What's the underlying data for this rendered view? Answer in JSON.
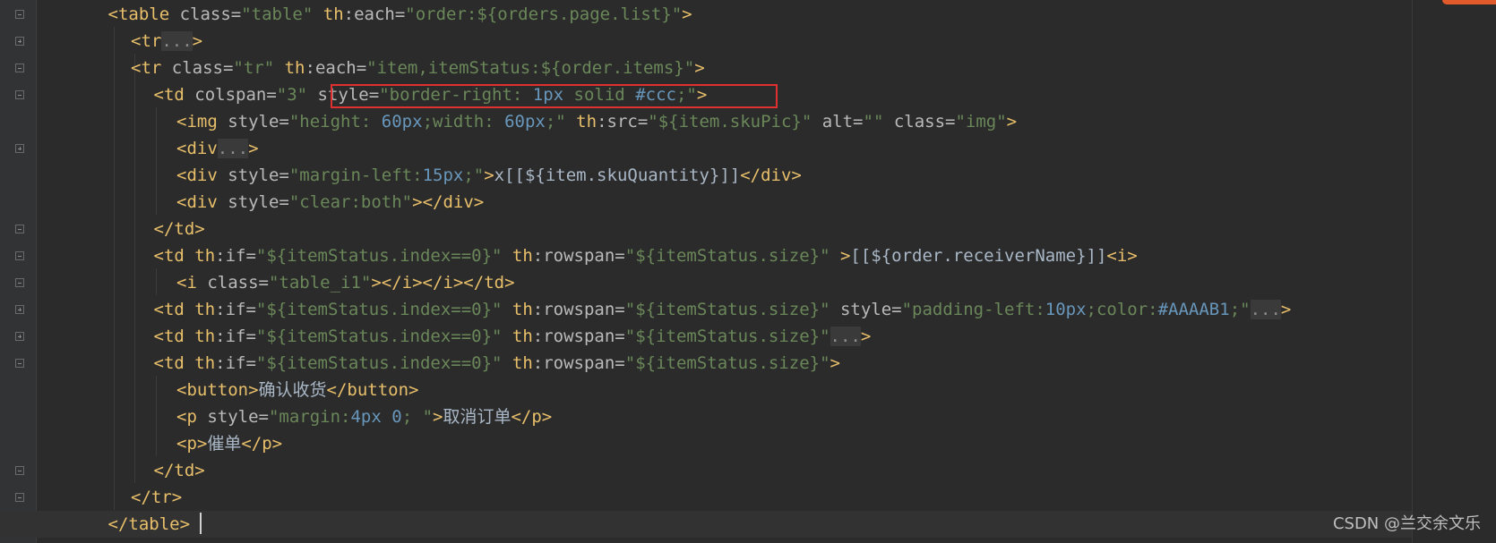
{
  "code_lines": [
    {
      "indent": 3,
      "parts": [
        {
          "t": "<",
          "c": "t"
        },
        {
          "t": "table",
          "c": "t"
        },
        {
          "t": " class=",
          "c": "a"
        },
        {
          "t": "\"table\"",
          "c": "s"
        },
        {
          "t": " th",
          "c": "t"
        },
        {
          "t": ":each=",
          "c": "a"
        },
        {
          "t": "\"",
          "c": "s"
        },
        {
          "t": "order:${orders.page.list}",
          "c": "s"
        },
        {
          "t": "\"",
          "c": "s"
        },
        {
          "t": ">",
          "c": "t"
        }
      ]
    },
    {
      "indent": 4,
      "parts": [
        {
          "t": "<tr",
          "c": "t"
        },
        {
          "t": "...",
          "c": "f"
        },
        {
          "t": ">",
          "c": "t"
        }
      ]
    },
    {
      "indent": 4,
      "parts": [
        {
          "t": "<tr",
          "c": "t"
        },
        {
          "t": " class=",
          "c": "a"
        },
        {
          "t": "\"tr\"",
          "c": "s"
        },
        {
          "t": " th",
          "c": "t"
        },
        {
          "t": ":each=",
          "c": "a"
        },
        {
          "t": "\"item,itemStatus:${order.items}\"",
          "c": "s"
        },
        {
          "t": ">",
          "c": "t"
        }
      ]
    },
    {
      "indent": 5,
      "parts": [
        {
          "t": "<td",
          "c": "t"
        },
        {
          "t": " colspan=",
          "c": "a"
        },
        {
          "t": "\"3\"",
          "c": "s"
        },
        {
          "t": " style=",
          "c": "a"
        },
        {
          "t": "\"border-right: ",
          "c": "s"
        },
        {
          "t": "1px",
          "c": "n"
        },
        {
          "t": " solid ",
          "c": "s"
        },
        {
          "t": "#ccc",
          "c": "n"
        },
        {
          "t": ";\"",
          "c": "s"
        },
        {
          "t": ">",
          "c": "t"
        }
      ]
    },
    {
      "indent": 6,
      "parts": [
        {
          "t": "<img",
          "c": "t"
        },
        {
          "t": " style=",
          "c": "a"
        },
        {
          "t": "\"height: ",
          "c": "s"
        },
        {
          "t": "60px",
          "c": "n"
        },
        {
          "t": ";width: ",
          "c": "s"
        },
        {
          "t": "60px",
          "c": "n"
        },
        {
          "t": ";\"",
          "c": "s"
        },
        {
          "t": " th",
          "c": "t"
        },
        {
          "t": ":src=",
          "c": "a"
        },
        {
          "t": "\"${item.skuPic}\"",
          "c": "s"
        },
        {
          "t": " alt=",
          "c": "a"
        },
        {
          "t": "\"\"",
          "c": "s"
        },
        {
          "t": " class=",
          "c": "a"
        },
        {
          "t": "\"img\"",
          "c": "s"
        },
        {
          "t": ">",
          "c": "t"
        }
      ]
    },
    {
      "indent": 6,
      "parts": [
        {
          "t": "<div",
          "c": "t"
        },
        {
          "t": "...",
          "c": "f"
        },
        {
          "t": ">",
          "c": "t"
        }
      ]
    },
    {
      "indent": 6,
      "parts": [
        {
          "t": "<div",
          "c": "t"
        },
        {
          "t": " style=",
          "c": "a"
        },
        {
          "t": "\"margin-left:",
          "c": "s"
        },
        {
          "t": "15px",
          "c": "n"
        },
        {
          "t": ";\"",
          "c": "s"
        },
        {
          "t": ">",
          "c": "t"
        },
        {
          "t": "x[[${item.skuQuantity}]]",
          "c": "d"
        },
        {
          "t": "</div>",
          "c": "t"
        }
      ]
    },
    {
      "indent": 6,
      "parts": [
        {
          "t": "<div",
          "c": "t"
        },
        {
          "t": " style=",
          "c": "a"
        },
        {
          "t": "\"clear:both\"",
          "c": "s"
        },
        {
          "t": "></div>",
          "c": "t"
        }
      ]
    },
    {
      "indent": 5,
      "parts": [
        {
          "t": "</td>",
          "c": "t"
        }
      ]
    },
    {
      "indent": 5,
      "parts": [
        {
          "t": "<td",
          "c": "t"
        },
        {
          "t": " th",
          "c": "t"
        },
        {
          "t": ":if=",
          "c": "a"
        },
        {
          "t": "\"${itemStatus.index==0}\"",
          "c": "s"
        },
        {
          "t": " th",
          "c": "t"
        },
        {
          "t": ":rowspan=",
          "c": "a"
        },
        {
          "t": "\"${itemStatus.size}\"",
          "c": "s"
        },
        {
          "t": " >",
          "c": "t"
        },
        {
          "t": "[[${order.receiverName}]]",
          "c": "d"
        },
        {
          "t": "<i>",
          "c": "t"
        }
      ]
    },
    {
      "indent": 6,
      "parts": [
        {
          "t": "<i",
          "c": "t"
        },
        {
          "t": " class=",
          "c": "a"
        },
        {
          "t": "\"table_i1\"",
          "c": "s"
        },
        {
          "t": "></i></i></td>",
          "c": "t"
        }
      ]
    },
    {
      "indent": 5,
      "parts": [
        {
          "t": "<td",
          "c": "t"
        },
        {
          "t": " th",
          "c": "t"
        },
        {
          "t": ":if=",
          "c": "a"
        },
        {
          "t": "\"${itemStatus.index==0}\"",
          "c": "s"
        },
        {
          "t": " th",
          "c": "t"
        },
        {
          "t": ":rowspan=",
          "c": "a"
        },
        {
          "t": "\"${itemStatus.size}\"",
          "c": "s"
        },
        {
          "t": " style=",
          "c": "a"
        },
        {
          "t": "\"padding-left:",
          "c": "s"
        },
        {
          "t": "10px",
          "c": "n"
        },
        {
          "t": ";color:",
          "c": "s"
        },
        {
          "t": "#AAAAB1",
          "c": "n"
        },
        {
          "t": ";\"",
          "c": "s"
        },
        {
          "t": "...",
          "c": "f"
        },
        {
          "t": ">",
          "c": "t"
        }
      ]
    },
    {
      "indent": 5,
      "parts": [
        {
          "t": "<td",
          "c": "t"
        },
        {
          "t": " th",
          "c": "t"
        },
        {
          "t": ":if=",
          "c": "a"
        },
        {
          "t": "\"${itemStatus.index==0}\"",
          "c": "s"
        },
        {
          "t": " th",
          "c": "t"
        },
        {
          "t": ":rowspan=",
          "c": "a"
        },
        {
          "t": "\"${itemStatus.size}\"",
          "c": "s"
        },
        {
          "t": "...",
          "c": "f"
        },
        {
          "t": ">",
          "c": "t"
        }
      ]
    },
    {
      "indent": 5,
      "parts": [
        {
          "t": "<td",
          "c": "t"
        },
        {
          "t": " th",
          "c": "t"
        },
        {
          "t": ":if=",
          "c": "a"
        },
        {
          "t": "\"${itemStatus.index==0}\"",
          "c": "s"
        },
        {
          "t": " th",
          "c": "t"
        },
        {
          "t": ":rowspan=",
          "c": "a"
        },
        {
          "t": "\"${itemStatus.size}\"",
          "c": "s"
        },
        {
          "t": ">",
          "c": "t"
        }
      ]
    },
    {
      "indent": 6,
      "parts": [
        {
          "t": "<button>",
          "c": "t"
        },
        {
          "t": "确认收货",
          "c": "d"
        },
        {
          "t": "</button>",
          "c": "t"
        }
      ]
    },
    {
      "indent": 6,
      "parts": [
        {
          "t": "<p",
          "c": "t"
        },
        {
          "t": " style=",
          "c": "a"
        },
        {
          "t": "\"margin:",
          "c": "s"
        },
        {
          "t": "4px 0",
          "c": "n"
        },
        {
          "t": "; \"",
          "c": "s"
        },
        {
          "t": ">",
          "c": "t"
        },
        {
          "t": "取消订单",
          "c": "d"
        },
        {
          "t": "</p>",
          "c": "t"
        }
      ]
    },
    {
      "indent": 6,
      "parts": [
        {
          "t": "<p>",
          "c": "t"
        },
        {
          "t": "催单",
          "c": "d"
        },
        {
          "t": "</p>",
          "c": "t"
        }
      ]
    },
    {
      "indent": 5,
      "parts": [
        {
          "t": "</td>",
          "c": "t"
        }
      ]
    },
    {
      "indent": 4,
      "parts": [
        {
          "t": "</tr>",
          "c": "t"
        }
      ]
    },
    {
      "indent": 3,
      "parts": [
        {
          "t": "</table>",
          "c": "t"
        }
      ]
    }
  ],
  "fold_markers": [
    "minus",
    "plus",
    "minus",
    "minus",
    "",
    "plus",
    "",
    "",
    "minus",
    "minus",
    "minus",
    "plus",
    "plus",
    "minus",
    "",
    "",
    "",
    "minus",
    "minus",
    "minus"
  ],
  "watermark": "CSDN @兰交余文乐",
  "colors": {
    "background": "#2b2b2b",
    "tag": "#e8bf6a",
    "attribute": "#bababa",
    "string": "#6a8759",
    "number": "#6897bb",
    "text": "#a9b7c6",
    "highlight_box": "#e03030"
  }
}
